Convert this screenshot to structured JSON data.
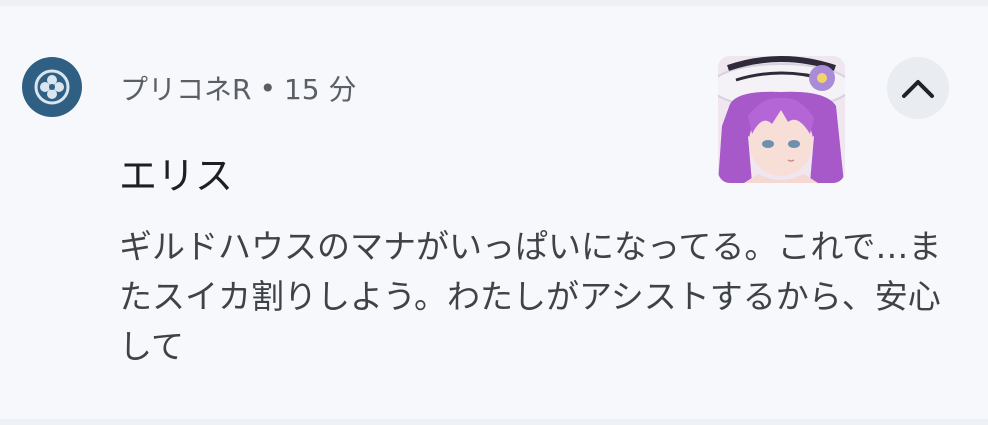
{
  "notification": {
    "app_icon": "clover-icon",
    "app_name": "プリコネR",
    "separator": "•",
    "time": "15 分",
    "title": "エリス",
    "message": "ギルドハウスのマナがいっぱいになってる。これで…またスイカ割りしよう。わたしがアシストするから、安心して",
    "thumbnail": "character-portrait",
    "expand_icon": "chevron-up-icon"
  },
  "colors": {
    "background": "#f6f8fb",
    "app_icon_bg": "#2f5f83",
    "expand_button_bg": "#e9ecf0",
    "title_text": "#1d1f22",
    "body_text": "#3f4348",
    "meta_text": "#5a5f66"
  }
}
